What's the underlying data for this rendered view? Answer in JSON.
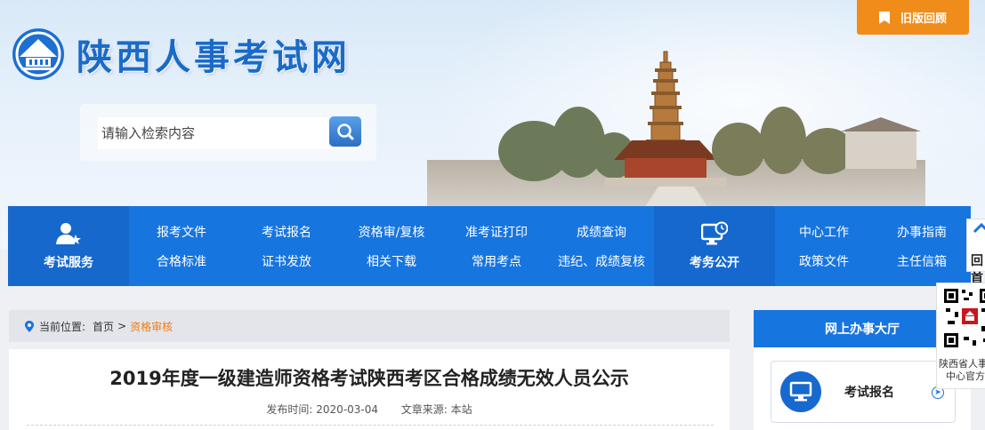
{
  "header": {
    "site_title": "陕西人事考试网",
    "old_version_label": "旧版回顾",
    "search": {
      "placeholder": "请输入检索内容",
      "value": ""
    }
  },
  "nav": {
    "exam_service": "考试服务",
    "columns_left": [
      [
        "报考文件",
        "合格标准"
      ],
      [
        "考试报名",
        "证书发放"
      ],
      [
        "资格审/复核",
        "相关下载"
      ],
      [
        "准考证打印",
        "常用考点"
      ],
      [
        "成绩查询",
        "违纪、成绩复核"
      ]
    ],
    "exam_public": "考务公开",
    "columns_right": [
      [
        "中心工作",
        "政策文件"
      ],
      [
        "办事指南",
        "主任信箱"
      ]
    ]
  },
  "breadcrumb": {
    "prefix": "当前位置:",
    "home": "首页",
    "separator": ">",
    "current": "资格审核"
  },
  "article": {
    "title": "2019年度一级建造师资格考试陕西考区合格成绩无效人员公示",
    "publish_time_label": "发布时间:",
    "publish_time": "2020-03-04",
    "source_label": "文章来源:",
    "source": "本站"
  },
  "side": {
    "header": "网上办事大厅",
    "exam_registration": "考试报名"
  },
  "float": {
    "home_fragment": "回首",
    "qr_caption_line1": "陕西省人事",
    "qr_caption_line2": "中心官方"
  },
  "colors": {
    "primary_blue": "#1775e0",
    "orange": "#f08c1a",
    "highlight": "#f07c12"
  }
}
